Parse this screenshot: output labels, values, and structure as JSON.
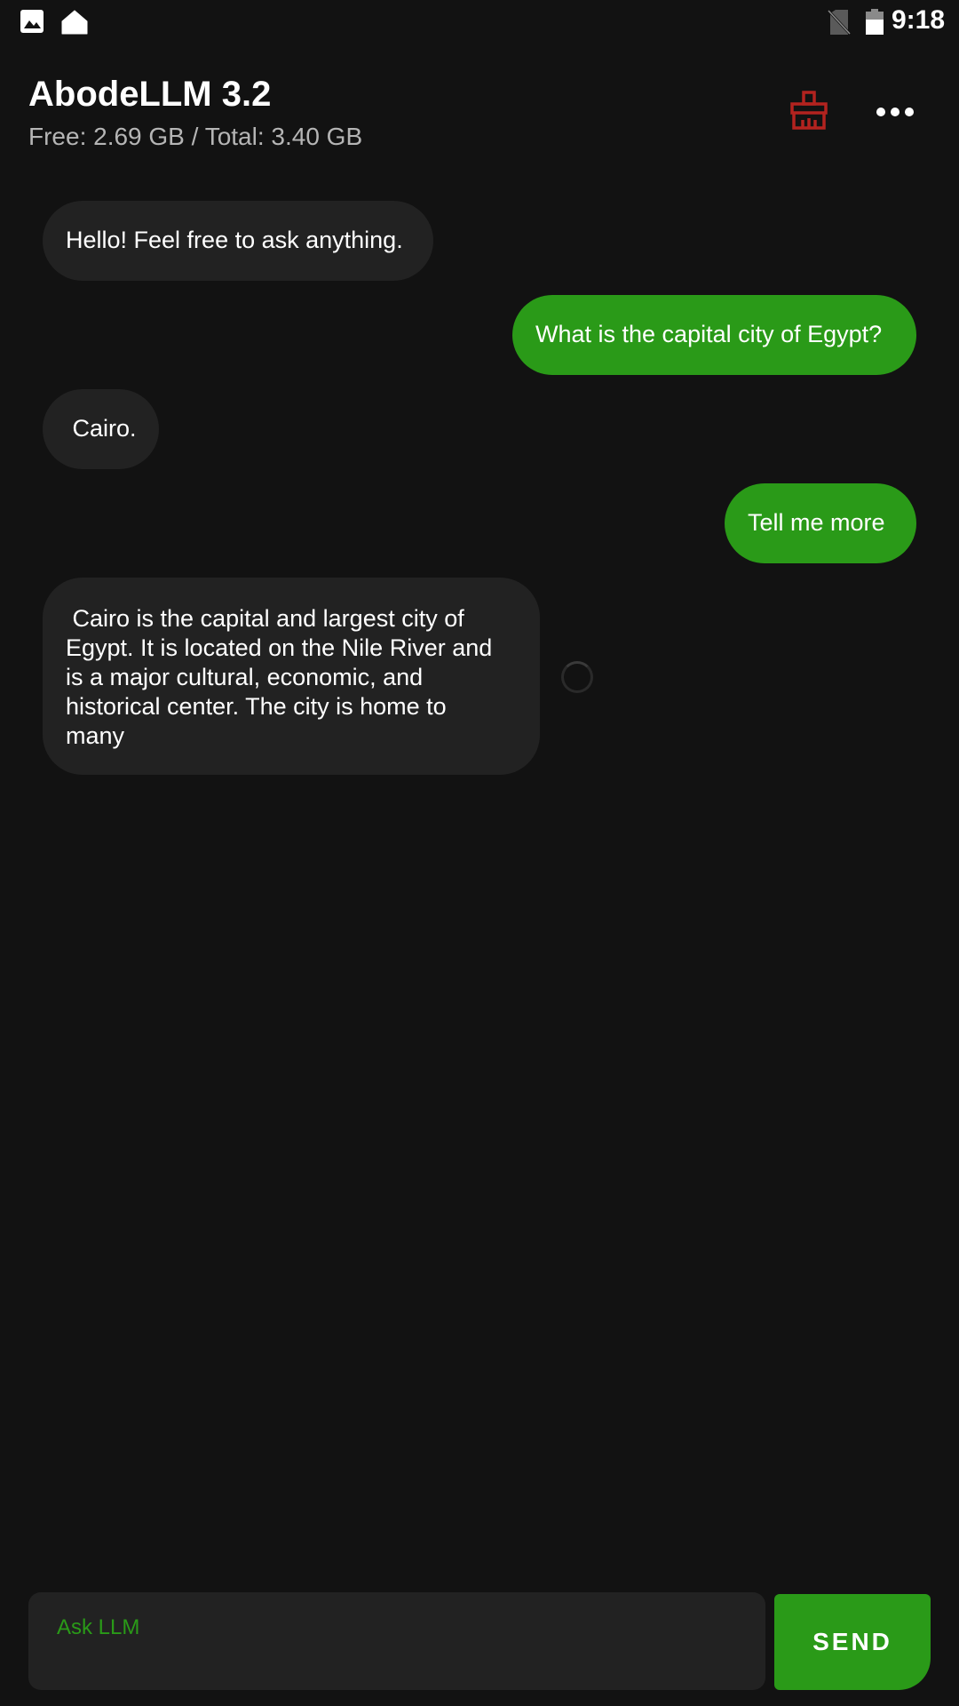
{
  "status_bar": {
    "time": "9:18",
    "icons": [
      "image-icon",
      "home-icon",
      "no-sim-icon",
      "battery-icon"
    ]
  },
  "header": {
    "title": "AbodeLLM 3.2",
    "memory": "Free: 2.69 GB / Total: 3.40 GB",
    "clear_icon": "broom-icon",
    "menu_icon": "more-horizontal-icon"
  },
  "messages": [
    {
      "role": "bot",
      "text": "Hello! Feel free to ask anything."
    },
    {
      "role": "user",
      "text": "What is the capital city of Egypt?"
    },
    {
      "role": "bot",
      "text": " Cairo."
    },
    {
      "role": "user",
      "text": "Tell me more"
    },
    {
      "role": "bot",
      "text": " Cairo is the capital and largest city of Egypt. It is located on the Nile River and is a major cultural, economic, and historical center. The city is home to many"
    }
  ],
  "input": {
    "placeholder": "Ask LLM",
    "value": ""
  },
  "send_button": {
    "label": "SEND"
  },
  "colors": {
    "background": "#121212",
    "bot_bubble": "#222222",
    "user_bubble": "#2a9a18",
    "accent_green": "#2a9a18",
    "clear_icon_red": "#b3231f"
  }
}
